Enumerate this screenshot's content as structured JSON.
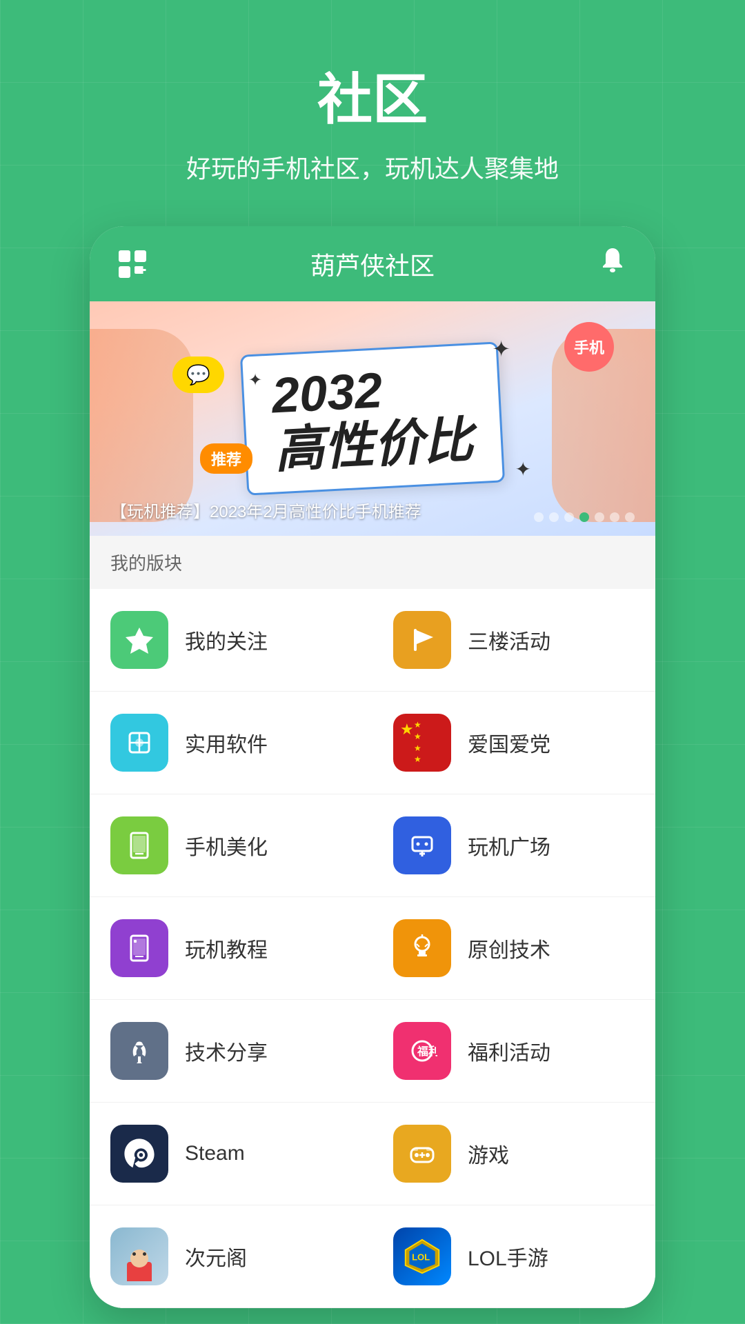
{
  "page": {
    "title": "社区",
    "subtitle": "好玩的手机社区，玩机达人聚集地"
  },
  "header": {
    "title": "葫芦侠社区",
    "grid_icon": "grid-icon",
    "bell_icon": "bell-icon"
  },
  "banner": {
    "main_text_top": "2032",
    "main_text_bottom": "高性价比",
    "badge_phone": "手机",
    "badge_recommend": "推荐",
    "caption": "【玩机推荐】2023年2月高性价比手机推荐",
    "dots_count": 7,
    "active_dot": 4
  },
  "my_blocks": {
    "label": "我的版块"
  },
  "menu_items": [
    {
      "id": "follow",
      "label": "我的关注",
      "icon": "star",
      "color": "green"
    },
    {
      "id": "activity",
      "label": "三楼活动",
      "icon": "flag",
      "color": "yellow"
    },
    {
      "id": "software",
      "label": "实用软件",
      "icon": "box",
      "color": "cyan"
    },
    {
      "id": "patriot",
      "label": "爱国爱党",
      "icon": "flag-cn",
      "color": "red"
    },
    {
      "id": "beauty",
      "label": "手机美化",
      "icon": "book",
      "color": "light-green"
    },
    {
      "id": "gaming-square",
      "label": "玩机广场",
      "icon": "phone-rotate",
      "color": "blue"
    },
    {
      "id": "tutorial",
      "label": "玩机教程",
      "icon": "bookmark",
      "color": "purple"
    },
    {
      "id": "original-tech",
      "label": "原创技术",
      "icon": "bulb",
      "color": "orange"
    },
    {
      "id": "tech-share",
      "label": "技术分享",
      "icon": "wrench",
      "color": "gray"
    },
    {
      "id": "welfare",
      "label": "福利活动",
      "icon": "gift",
      "color": "pink"
    },
    {
      "id": "steam",
      "label": "Steam",
      "icon": "steam",
      "color": "dark-navy"
    },
    {
      "id": "game",
      "label": "游戏",
      "icon": "gamepad",
      "color": "gold"
    },
    {
      "id": "anime",
      "label": "次元阁",
      "icon": "anime-img",
      "color": "anime"
    },
    {
      "id": "lol",
      "label": "LOL手游",
      "icon": "lol-img",
      "color": "lol"
    }
  ]
}
